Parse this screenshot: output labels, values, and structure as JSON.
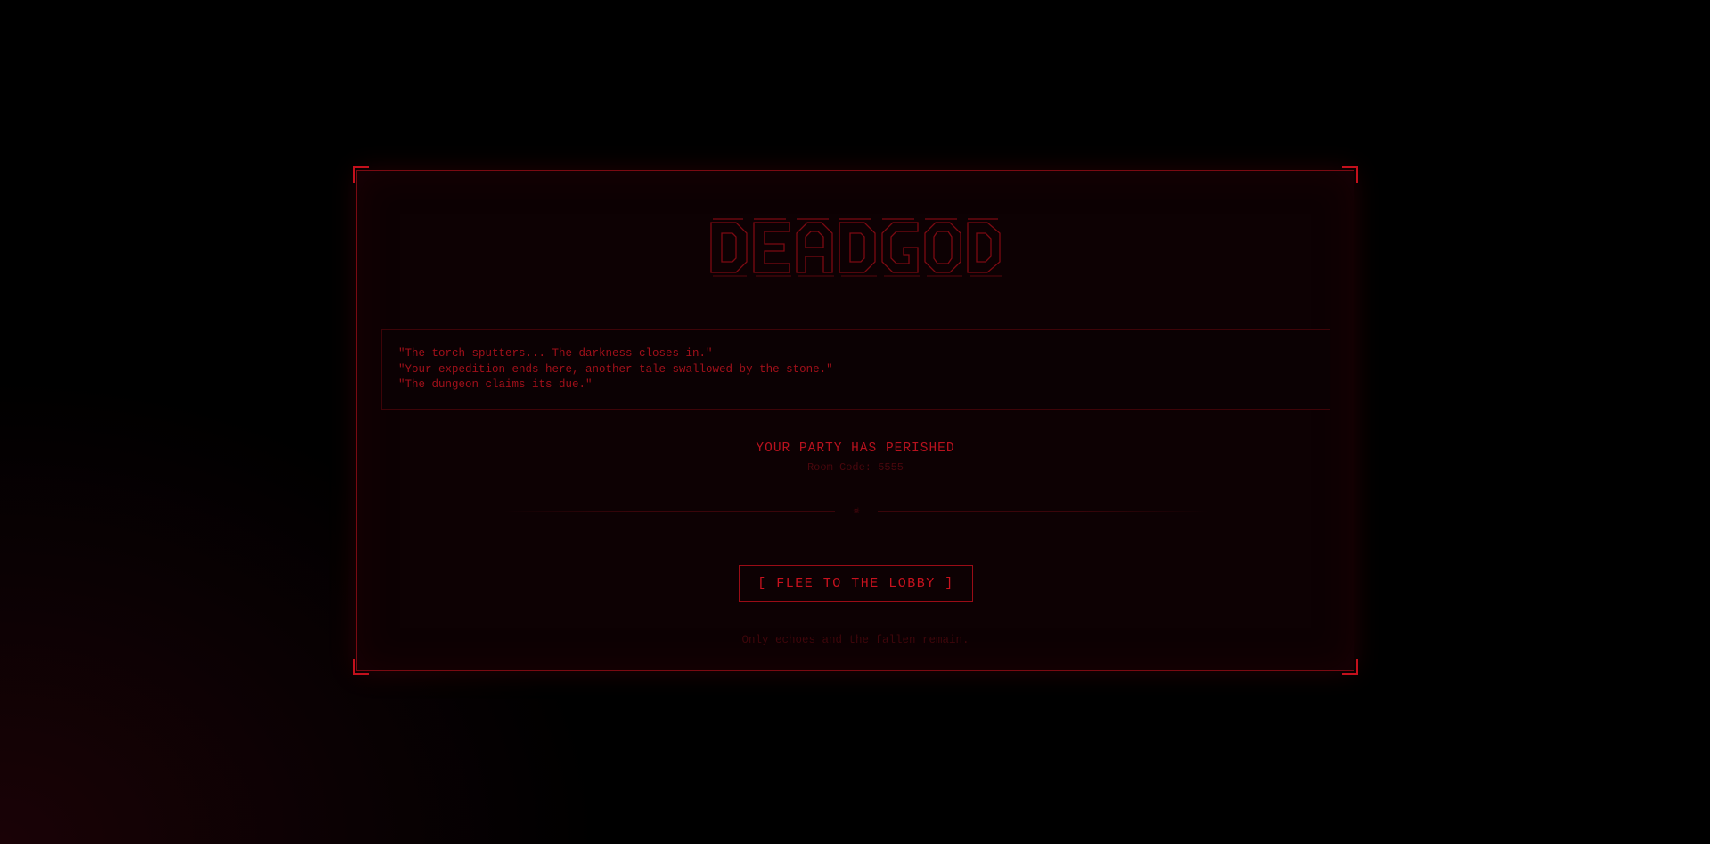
{
  "game_over": {
    "logo_text": "DEADGOD",
    "quotes": [
      "\"The torch sputters... The darkness closes in.\"",
      "\"Your expedition ends here, another tale swallowed by the stone.\"",
      "\"The dungeon claims its due.\""
    ],
    "status_title": "YOUR PARTY HAS PERISHED",
    "room_code": "Room Code: 5555",
    "divider_icon": "skull-icon",
    "button_label": "[ FLEE TO THE LOBBY ]",
    "footer_text": "Only echoes and the fallen remain."
  },
  "colors": {
    "accent": "#c8121e",
    "panel_bg": "#0d0103",
    "page_bg": "#000000"
  }
}
